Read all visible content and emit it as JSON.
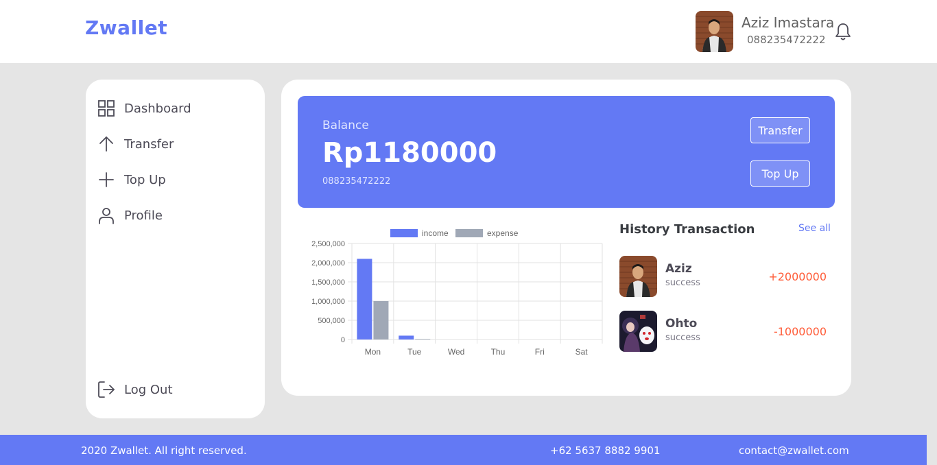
{
  "header": {
    "logo": "Zwallet",
    "user_name": "Aziz Imastara",
    "user_phone": "088235472222"
  },
  "sidebar": {
    "items": [
      {
        "label": "Dashboard",
        "icon": "grid-icon"
      },
      {
        "label": "Transfer",
        "icon": "arrow-up-icon"
      },
      {
        "label": "Top Up",
        "icon": "plus-icon"
      },
      {
        "label": "Profile",
        "icon": "user-icon"
      }
    ],
    "logout": {
      "label": "Log Out",
      "icon": "logout-icon"
    }
  },
  "balance": {
    "label": "Balance",
    "amount": "Rp1180000",
    "phone": "088235472222",
    "transfer_label": "Transfer",
    "topup_label": "Top Up"
  },
  "chart_data": {
    "type": "bar",
    "categories": [
      "Mon",
      "Tue",
      "Wed",
      "Thu",
      "Fri",
      "Sat"
    ],
    "series": [
      {
        "name": "income",
        "values": [
          2100000,
          100000,
          0,
          0,
          0,
          0
        ],
        "color": "#6379f4"
      },
      {
        "name": "expense",
        "values": [
          1000000,
          15000,
          0,
          0,
          0,
          0
        ],
        "color": "#a0a8b6"
      }
    ],
    "ylim": [
      0,
      2500000
    ],
    "yticks": [
      "2,500,000",
      "2,000,000",
      "1,500,000",
      "1,000,000",
      "500,000",
      "0"
    ],
    "legend": "top",
    "grid": true
  },
  "history": {
    "title": "History Transaction",
    "see_all": "See all",
    "items": [
      {
        "name": "Aziz",
        "status": "success",
        "amount": "+2000000",
        "color": "#ff5b37"
      },
      {
        "name": "Ohto",
        "status": "success",
        "amount": "-1000000",
        "color": "#ff5b37"
      }
    ]
  },
  "footer": {
    "copyright": "2020 Zwallet. All right reserved.",
    "phone": "+62 5637 8882 9901",
    "email": "contact@zwallet.com"
  },
  "colors": {
    "accent": "#6379f4",
    "amount": "#ff5b37"
  }
}
